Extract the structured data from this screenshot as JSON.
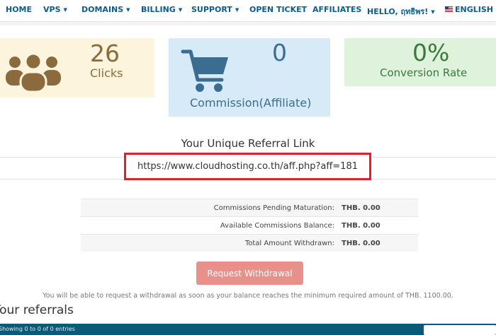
{
  "nav": {
    "items": [
      {
        "label": "HOME",
        "caret": false
      },
      {
        "label": "VPS",
        "caret": true
      },
      {
        "label": "DOMAINS",
        "caret": true
      },
      {
        "label": "BILLING",
        "caret": true
      },
      {
        "label": "SUPPORT",
        "caret": true
      },
      {
        "label": "OPEN TICKET",
        "caret": false
      },
      {
        "label": "AFFILIATES",
        "caret": false
      },
      {
        "label": "HELLO, ฤทธิพร!",
        "caret": true
      },
      {
        "label": "ENGLISH",
        "caret": true
      }
    ],
    "caret_glyph": "▼",
    "language_flag_icon": "us-flag-icon"
  },
  "stats": {
    "clicks": {
      "value": "26",
      "label": "Clicks",
      "icon": "users-group-icon",
      "color": "#8b6a3d"
    },
    "commission": {
      "value": "0",
      "label": "Commission(Affiliate)",
      "icon": "shopping-cart-icon",
      "color": "#3b6c92"
    },
    "conversion": {
      "value": "0%",
      "label": "Conversion Rate",
      "color": "#3a7a3a"
    }
  },
  "referral": {
    "title": "Your Unique Referral Link",
    "link": "https://www.cloudhosting.co.th/aff.php?aff=181",
    "highlight_color": "#e0202a"
  },
  "summary": [
    {
      "label": "Commissions Pending Maturation:",
      "value": "THB. 0.00"
    },
    {
      "label": "Available Commissions Balance:",
      "value": "THB. 0.00"
    },
    {
      "label": "Total Amount Withdrawn:",
      "value": "THB. 0.00"
    }
  ],
  "withdraw": {
    "button_label": "Request Withdrawal",
    "note": "You will be able to request a withdrawal as soon as your balance reaches the minimum required amount of THB. 1100.00."
  },
  "referrals": {
    "title": "Your referrals",
    "showing": "Showing 0 to 0 of 0 entries"
  }
}
